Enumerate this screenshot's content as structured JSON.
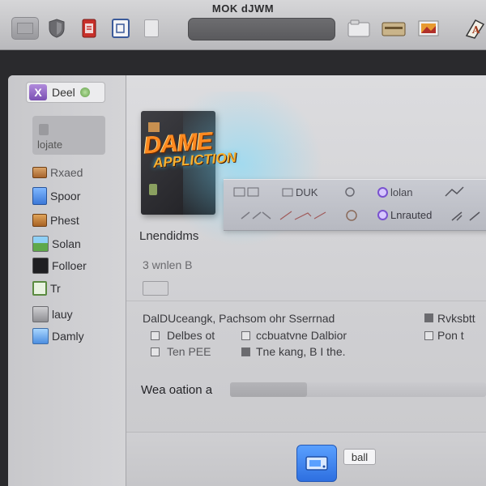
{
  "window": {
    "title": "MOK dJWM"
  },
  "toolbar": {
    "buttons": [
      {
        "name": "view-button"
      },
      {
        "name": "shield-button"
      },
      {
        "name": "document-button"
      },
      {
        "name": "note-button"
      },
      {
        "name": "blank-button"
      },
      {
        "name": "folder-button"
      },
      {
        "name": "box-button"
      },
      {
        "name": "photo-button"
      },
      {
        "name": "dictionary-button"
      }
    ],
    "search": {
      "placeholder": ""
    }
  },
  "sidebar": {
    "header": {
      "label": "Deel"
    },
    "selected": {
      "label": "lojate"
    },
    "items": [
      {
        "label": "Rxaed",
        "icon": "card-icon"
      },
      {
        "label": "Spoor",
        "icon": "document-icon"
      },
      {
        "label": "Phest",
        "icon": "folder-icon"
      },
      {
        "label": "Solan",
        "icon": "image-icon"
      },
      {
        "label": "Folloer",
        "icon": "monitor-icon"
      },
      {
        "label": "Tr",
        "icon": "terminal-icon"
      },
      {
        "label": "lauy",
        "icon": "disk-icon"
      },
      {
        "label": "Damly",
        "icon": "picture-icon"
      }
    ]
  },
  "main": {
    "game_title_line1": "DAME",
    "game_title_line2": "APPLICTION",
    "overlay": {
      "items": [
        "DUK",
        "lolan",
        "Lnrauted"
      ]
    },
    "section_heading": "Lnendidms",
    "sub_label": "3 wnlen B",
    "rows": {
      "r1_left": "DalDUceangk, Pachsom ohr Sserrnad",
      "r1_right": "Rvksbtt",
      "r2_left": "Delbes ot",
      "r2_mid": "ccbuatvne Dalbior",
      "r2_right": "Pon t",
      "r3_left": "Ten PEE",
      "r3_mid": "Tne kang, B I the."
    },
    "progress": {
      "label": "Wea oation a",
      "value": 0.3
    },
    "buttons": {
      "secondary_label": "ball"
    }
  }
}
